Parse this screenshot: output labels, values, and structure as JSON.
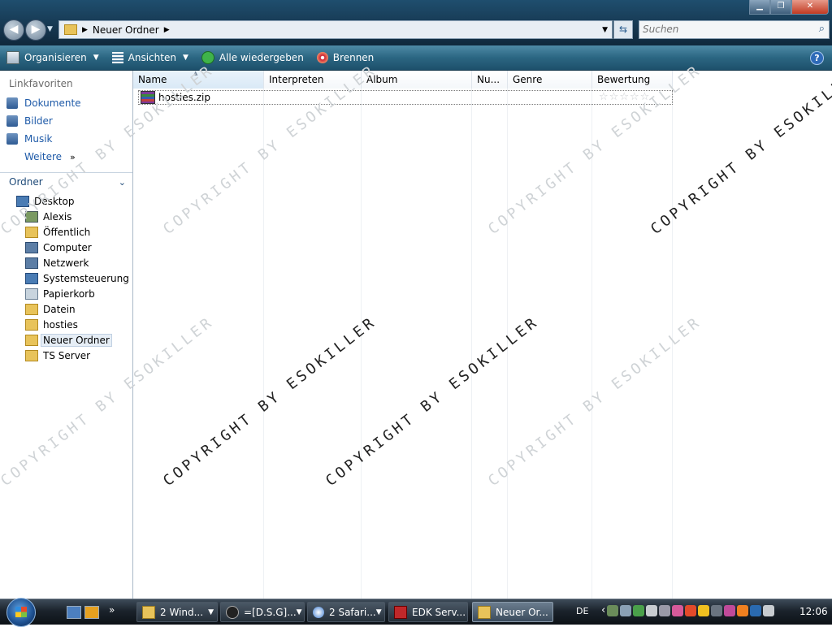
{
  "window": {
    "address": {
      "crumb": "Neuer Ordner"
    },
    "search": {
      "placeholder": "Suchen"
    },
    "controls": {
      "minimize": "▁",
      "maximize": "❐",
      "close": "✕"
    }
  },
  "toolbar": {
    "organize": "Organisieren",
    "views": "Ansichten",
    "play_all": "Alle wiedergeben",
    "burn": "Brennen",
    "help": "?"
  },
  "sidebar": {
    "favorites_title": "Linkfavoriten",
    "favorites": [
      {
        "label": "Dokumente",
        "icon": "documents-icon"
      },
      {
        "label": "Bilder",
        "icon": "pictures-icon"
      },
      {
        "label": "Musik",
        "icon": "music-icon"
      }
    ],
    "more": "Weitere",
    "folders_title": "Ordner",
    "tree": [
      {
        "label": "Desktop",
        "level": 0,
        "icon": "desktop-icon"
      },
      {
        "label": "Alexis",
        "level": 1,
        "icon": "user-folder-icon"
      },
      {
        "label": "Öffentlich",
        "level": 1,
        "icon": "folder-icon"
      },
      {
        "label": "Computer",
        "level": 1,
        "icon": "computer-icon"
      },
      {
        "label": "Netzwerk",
        "level": 1,
        "icon": "network-icon"
      },
      {
        "label": "Systemsteuerung",
        "level": 1,
        "icon": "control-panel-icon"
      },
      {
        "label": "Papierkorb",
        "level": 1,
        "icon": "recycle-bin-icon"
      },
      {
        "label": "Datein",
        "level": 1,
        "icon": "folder-icon"
      },
      {
        "label": "hosties",
        "level": 1,
        "icon": "folder-icon"
      },
      {
        "label": "Neuer Ordner",
        "level": 1,
        "icon": "folder-icon",
        "selected": true
      },
      {
        "label": "TS Server",
        "level": 1,
        "icon": "folder-icon"
      }
    ]
  },
  "list": {
    "columns": [
      "Name",
      "Interpreten",
      "Album",
      "Nu...",
      "Genre",
      "Bewertung"
    ],
    "rows": [
      {
        "name": "hosties.zip",
        "rating": 0,
        "rating_max": 5
      }
    ]
  },
  "watermark": {
    "text": "COPYRIGHT BY ESOKILLER"
  },
  "taskbar": {
    "more": "»",
    "buttons": [
      {
        "label": "2 Wind...",
        "icon": "explorer-icon",
        "dropdown": true
      },
      {
        "label": "=[D.S.G]...",
        "icon": "steam-icon",
        "dropdown": true
      },
      {
        "label": "2 Safari...",
        "icon": "safari-icon",
        "dropdown": true
      },
      {
        "label": "EDK Serv...",
        "icon": "filezilla-icon",
        "dropdown": false
      },
      {
        "label": "Neuer Or...",
        "icon": "folder-icon",
        "dropdown": false,
        "active": true
      }
    ],
    "language": "DE",
    "tray_arrow": "‹",
    "clock": "12:06"
  }
}
